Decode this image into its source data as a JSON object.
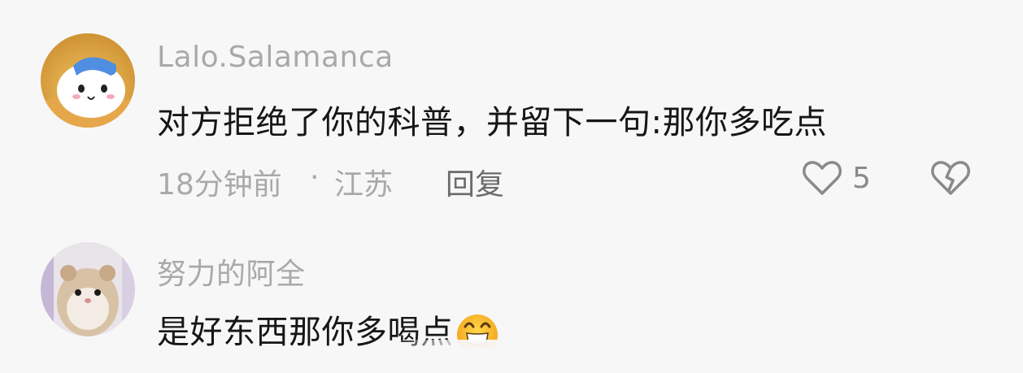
{
  "comments": [
    {
      "username": "Lalo.Salamanca",
      "text": "对方拒绝了你的科普，并留下一句:那你多吃点",
      "time": "18分钟前",
      "separator": "·",
      "location": "江苏",
      "reply_label": "回复",
      "like_count": "5",
      "avatar_icon": "cartoon-avatar-icon"
    },
    {
      "username": "努力的阿全",
      "text": "是好东西那你多喝点",
      "emoji": "grinning-squint-emoji",
      "avatar_icon": "hamster-avatar-icon"
    }
  ],
  "colors": {
    "background": "#f7f7f7",
    "username": "#a9a9a9",
    "content": "#161616",
    "meta": "#a9a9a9",
    "reply": "#6b6b6b"
  }
}
